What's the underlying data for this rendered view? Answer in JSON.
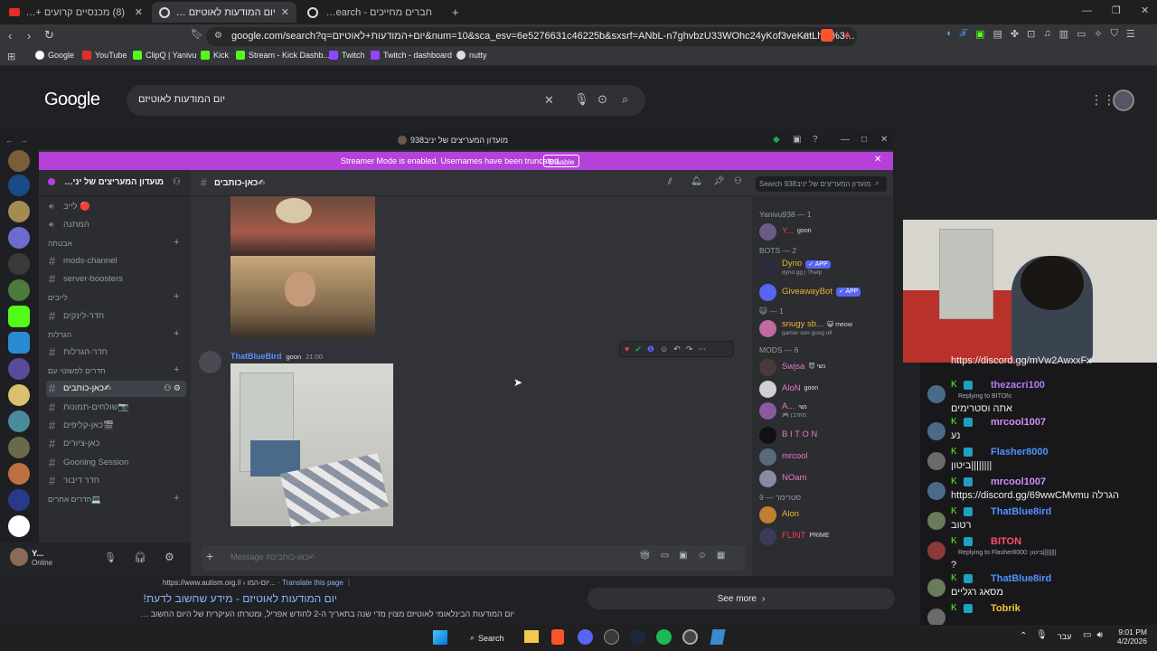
{
  "browser": {
    "tabs": [
      {
        "label": "(8) מכנסיים קרועים + כתוביות - בובה"
      },
      {
        "label": "יום המודעות לאוטיזם - Google Search"
      },
      {
        "label": "חברים מחייכים - Google Search"
      }
    ],
    "url": "google.com/search?q=יום+המודעות+לאוטיזם&num=10&sca_esv=6e5276631c46225b&sxsrf=ANbL-n7ghvbzU33WOhc24yKof3veKutLhQ%3A177515...",
    "bookmarks": [
      "Google",
      "YouTube",
      "ClipQ | Yanivu",
      "Kick",
      "Stream - Kick Dashb...",
      "Twitch",
      "Twitch - dashboard",
      "nutty"
    ]
  },
  "google": {
    "logo": "Google",
    "query": "יום המודעות לאוטיזם",
    "result_url": "https://www.autism.org.il › יום-המו...",
    "translate": "Translate this page",
    "result_title": "יום המודעות לאוטיזם - מידע שחשוב לדעת!",
    "result_snippet": "יום המודעות הבינלאומי לאוטיזם מצוין מדי שנה בתאריך ה-2 לחודש אפריל, ומטרתו העיקרית של היום החשוב הזה",
    "see_more": "See more"
  },
  "discord": {
    "window_title": "מועדון המעריצים של יניב938",
    "banner_text": "Streamer Mode is enabled. Usernames have been truncated.",
    "banner_button": "Disable",
    "server_name": "מועדון המעריצים של יניב938...",
    "channel_header": "כאן-כותבים✍",
    "search_placeholder": "Search מועדון המעריצים של יניב938",
    "channels": [
      {
        "label": "לייב 🔴",
        "type": "voice"
      },
      {
        "label": "המתנה",
        "type": "voice"
      },
      {
        "cat": "אבטחה"
      },
      {
        "label": "mods-channel",
        "type": "text"
      },
      {
        "label": "server-boosters",
        "type": "text"
      },
      {
        "cat": "לייבים"
      },
      {
        "label": "חדר-לינקים",
        "type": "text"
      },
      {
        "cat": "הגרלות"
      },
      {
        "label": "חדר-הגרלות",
        "type": "text"
      },
      {
        "cat": "חדרים לפשוטי עם"
      },
      {
        "label": "כאן-כותבים✍",
        "type": "text",
        "active": true
      },
      {
        "label": "שולחים-תמונות📷",
        "type": "text"
      },
      {
        "label": "כאן-קליפים🎬",
        "type": "text"
      },
      {
        "label": "כאן-ציורים",
        "type": "text"
      },
      {
        "label": "Gooning Session",
        "type": "text"
      },
      {
        "label": "חדר דיבור",
        "type": "text"
      },
      {
        "cat": "חדרים אחרים💻"
      }
    ],
    "message": {
      "author": "ThatBlueBird",
      "badge": "goon",
      "time": "21:00"
    },
    "input_placeholder": "Message #כאן-כותבים✍",
    "user": {
      "name": "Y...",
      "status": "Online"
    },
    "members": [
      {
        "header": "Yanivu938 — 1"
      },
      {
        "name": "Y...",
        "extra": "goon",
        "color": "#f23f43"
      },
      {
        "header": "BOTS — 2"
      },
      {
        "name": "Dyno",
        "tag": "✓ APP",
        "sub": "dyno.gg | ?help",
        "color": "#f0b232"
      },
      {
        "name": "GiveawayBot",
        "tag": "✓ APP",
        "color": "#f0b232"
      },
      {
        "header": "😺 — 1"
      },
      {
        "name": "snugy sb...",
        "extra": "😺 meow",
        "sub": "gamer son goog oil",
        "color": "#f0b232"
      },
      {
        "header": "MODS — 6"
      },
      {
        "name": "Swjsa",
        "extra": "😈 נשי",
        "color": "#e879c6"
      },
      {
        "name": "AloN",
        "extra": "goon",
        "color": "#e879c6"
      },
      {
        "name": "A...",
        "extra": "נשי",
        "sub": "🎮 מוזרבן",
        "color": "#e879c6"
      },
      {
        "name": "B I T O N",
        "color": "#e879c6"
      },
      {
        "name": "mrcool",
        "color": "#e879c6"
      },
      {
        "name": "NOam",
        "color": "#e879c6"
      },
      {
        "header": "סטרימר — 9"
      },
      {
        "name": "Alon",
        "color": "#f0b232"
      },
      {
        "name": "FLINT",
        "extra": "PRIME",
        "color": "#f23f43"
      }
    ]
  },
  "chat": [
    {
      "name": "",
      "text": "https://discord.gg/mVw2AwxxFx",
      "color": "#efeff1"
    },
    {
      "name": "thezacri100",
      "reply": "Replying to BITON:",
      "text": "אתה וסטרימים",
      "color": "#b57cf2"
    },
    {
      "name": "mrcool1007",
      "text": "נע",
      "color": "#d18ef7"
    },
    {
      "name": "Flasher8000",
      "text": "ביטון||||||||",
      "color": "#4f93ff"
    },
    {
      "name": "mrcool1007",
      "text": "https://discord.gg/69wwCMvmu הגרלה",
      "color": "#d18ef7"
    },
    {
      "name": "ThatBlue8ird",
      "text": "רטוב",
      "color": "#4f93ff"
    },
    {
      "name": "BITON",
      "reply": "Replying to Flasher8000: ביטון||||||||",
      "text": "?",
      "color": "#ff4f6b"
    },
    {
      "name": "ThatBlue8ird",
      "text": "מסאג רגליים",
      "color": "#4f93ff"
    },
    {
      "name": "Tobrik",
      "text": "",
      "color": "#f7c13b"
    }
  ],
  "taskbar": {
    "search": "Search",
    "lang": "עבר",
    "time": "9:01 PM",
    "date": "4/2/2026"
  }
}
